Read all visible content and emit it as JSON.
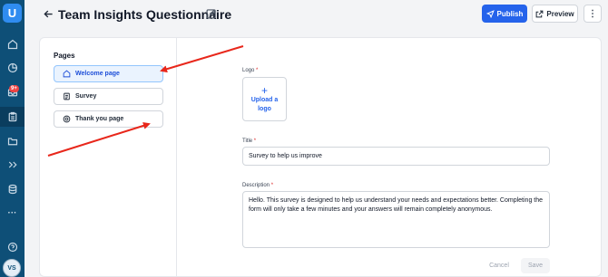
{
  "header": {
    "title": "Team Insights Questionnaire",
    "publish_label": "Publish",
    "preview_label": "Preview",
    "more_label": "⋮"
  },
  "sidebar": {
    "logo_glyph": "U",
    "badge": "9+",
    "avatar_initials": "VS",
    "more_dots": "···"
  },
  "pages": {
    "title": "Pages",
    "items": [
      {
        "label": "Welcome page",
        "icon": "home-icon",
        "active": true
      },
      {
        "label": "Survey",
        "icon": "document-icon",
        "active": false
      },
      {
        "label": "Thank you page",
        "icon": "badge-icon",
        "active": false
      }
    ]
  },
  "form": {
    "logo_label": "Logo",
    "upload_plus": "+",
    "upload_label_1": "Upload a",
    "upload_label_2": "logo",
    "title_label": "Title",
    "title_value": "Survey to help us improve",
    "description_label": "Description",
    "description_value": "Hello. This survey is designed to help us understand your needs and expectations better. Completing the form will only take a few minutes and your answers will remain completely anonymous.",
    "required_mark": "*",
    "cancel_label": "Cancel",
    "save_label": "Save"
  },
  "colors": {
    "rail": "#0e4f77",
    "accent": "#2563eb",
    "annotation_arrow": "#e8271b"
  }
}
